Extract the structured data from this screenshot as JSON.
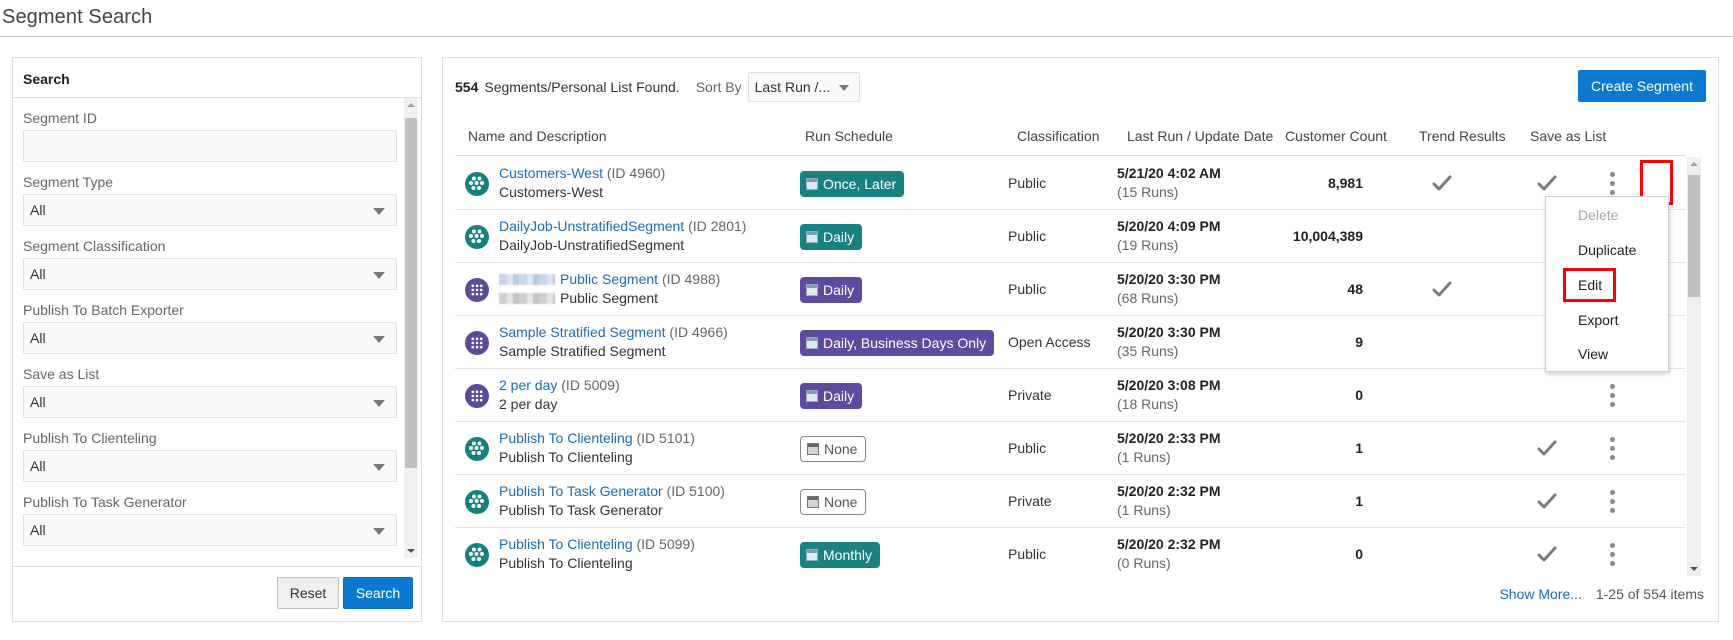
{
  "page": {
    "title": "Segment Search"
  },
  "search_panel": {
    "header": "Search",
    "fields": [
      {
        "label": "Segment ID",
        "type": "text",
        "value": ""
      },
      {
        "label": "Segment Type",
        "type": "select",
        "value": "All"
      },
      {
        "label": "Segment Classification",
        "type": "select",
        "value": "All"
      },
      {
        "label": "Publish To Batch Exporter",
        "type": "select",
        "value": "All"
      },
      {
        "label": "Save as List",
        "type": "select",
        "value": "All"
      },
      {
        "label": "Publish To Clienteling",
        "type": "select",
        "value": "All"
      },
      {
        "label": "Publish To Task Generator",
        "type": "select",
        "value": "All"
      }
    ],
    "reset_label": "Reset",
    "search_label": "Search"
  },
  "results": {
    "count": "554",
    "count_text": "Segments/Personal List Found.",
    "sort_label": "Sort By",
    "sort_value": "Last Run /...",
    "create_label": "Create Segment",
    "columns": [
      "Name and Description",
      "Run Schedule",
      "Classification",
      "Last Run / Update Date",
      "Customer Count",
      "Trend Results",
      "Save as List"
    ],
    "rows": [
      {
        "icon": "teal",
        "name": "Customers-West",
        "id": "(ID 4960)",
        "desc": "Customers-West",
        "blurred_prefix": false,
        "schedule": "Once, Later",
        "schedule_style": "teal",
        "classification": "Public",
        "date": "5/21/20 4:02 AM",
        "runs": "(15 Runs)",
        "count": "8,981",
        "trend": true,
        "save_list": true
      },
      {
        "icon": "teal",
        "name": "DailyJob-UnstratifiedSegment",
        "id": "(ID 2801)",
        "desc": "DailyJob-UnstratifiedSegment",
        "blurred_prefix": false,
        "schedule": "Daily",
        "schedule_style": "teal",
        "classification": "Public",
        "date": "5/20/20 4:09 PM",
        "runs": "(19 Runs)",
        "count": "10,004,389",
        "trend": false,
        "save_list": false
      },
      {
        "icon": "purple",
        "name": "Public Segment",
        "id": "(ID 4988)",
        "desc": "Public Segment",
        "blurred_prefix": true,
        "schedule": "Daily",
        "schedule_style": "purple",
        "classification": "Public",
        "date": "5/20/20 3:30 PM",
        "runs": "(68 Runs)",
        "count": "48",
        "trend": true,
        "save_list": false
      },
      {
        "icon": "purple",
        "name": "Sample Stratified Segment",
        "id": "(ID 4966)",
        "desc": "Sample Stratified Segment",
        "blurred_prefix": false,
        "schedule": "Daily, Business Days Only",
        "schedule_style": "purple",
        "classification": "Open Access",
        "date": "5/20/20 3:30 PM",
        "runs": "(35 Runs)",
        "count": "9",
        "trend": false,
        "save_list": false
      },
      {
        "icon": "purple",
        "name": "2 per day",
        "id": "(ID 5009)",
        "desc": "2 per day",
        "blurred_prefix": false,
        "schedule": "Daily",
        "schedule_style": "purple",
        "classification": "Private",
        "date": "5/20/20 3:08 PM",
        "runs": "(18 Runs)",
        "count": "0",
        "trend": false,
        "save_list": false
      },
      {
        "icon": "teal",
        "name": "Publish To Clienteling",
        "id": "(ID 5101)",
        "desc": "Publish To Clienteling",
        "blurred_prefix": false,
        "schedule": "None",
        "schedule_style": "none",
        "classification": "Public",
        "date": "5/20/20 2:33 PM",
        "runs": "(1 Runs)",
        "count": "1",
        "trend": false,
        "save_list": true
      },
      {
        "icon": "teal",
        "name": "Publish To Task Generator",
        "id": "(ID 5100)",
        "desc": "Publish To Task Generator",
        "blurred_prefix": false,
        "schedule": "None",
        "schedule_style": "none",
        "classification": "Private",
        "date": "5/20/20 2:32 PM",
        "runs": "(1 Runs)",
        "count": "1",
        "trend": false,
        "save_list": true
      },
      {
        "icon": "teal",
        "name": "Publish To Clienteling",
        "id": "(ID 5099)",
        "desc": "Publish To Clienteling",
        "blurred_prefix": false,
        "schedule": "Monthly",
        "schedule_style": "teal",
        "classification": "Public",
        "date": "5/20/20 2:32 PM",
        "runs": "(0 Runs)",
        "count": "0",
        "trend": false,
        "save_list": true
      }
    ],
    "show_more": "Show More...",
    "pager": "1-25 of 554 items"
  },
  "actions_menu": {
    "items": [
      {
        "label": "Delete",
        "disabled": true
      },
      {
        "label": "Duplicate",
        "disabled": false
      },
      {
        "label": "Edit",
        "disabled": false,
        "highlighted": true
      },
      {
        "label": "Export",
        "disabled": false
      },
      {
        "label": "View",
        "disabled": false
      }
    ]
  },
  "colors": {
    "primary_button": "#0b79d0",
    "link": "#1c6bb3",
    "schedule_teal": "#17827f",
    "schedule_purple": "#5f4b9e",
    "highlight": "#ff0000"
  }
}
